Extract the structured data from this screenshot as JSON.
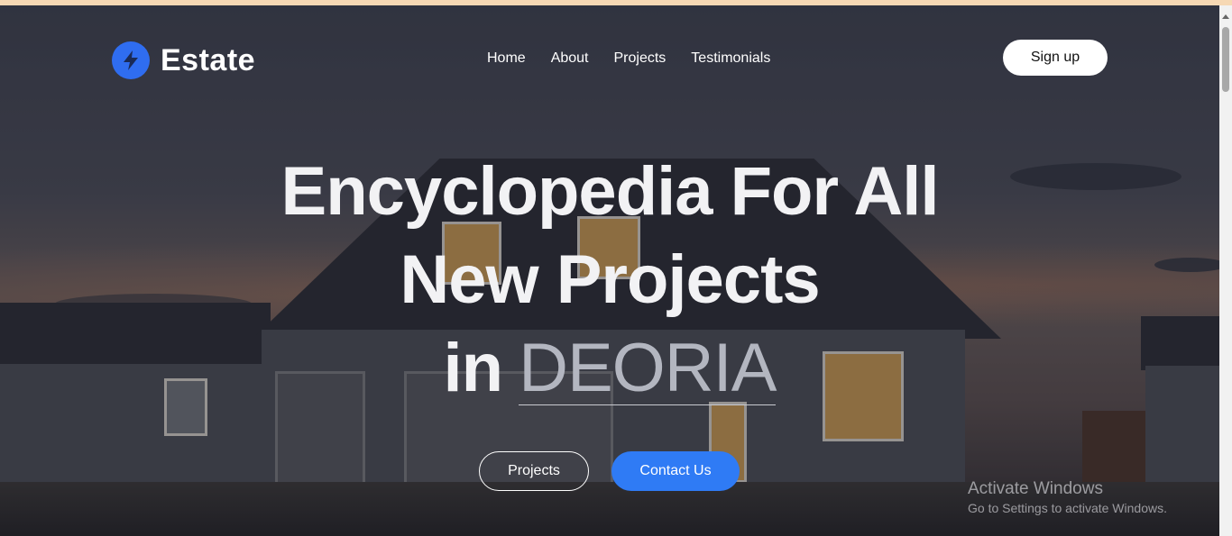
{
  "brand": {
    "name": "Estate",
    "icon": "lightning-bolt-icon",
    "accent": "#2f6df0"
  },
  "nav": {
    "items": [
      "Home",
      "About",
      "Projects",
      "Testimonials"
    ]
  },
  "header": {
    "signup_label": "Sign up"
  },
  "hero": {
    "line1": "Encyclopedia For All",
    "line2": "New Projects",
    "line3_prefix": "in",
    "city": "DEORIA",
    "cta_secondary": "Projects",
    "cta_primary": "Contact Us",
    "cta_primary_color": "#2f7bf5"
  },
  "watermark": {
    "title": "Activate Windows",
    "subtitle": "Go to Settings to activate Windows."
  }
}
